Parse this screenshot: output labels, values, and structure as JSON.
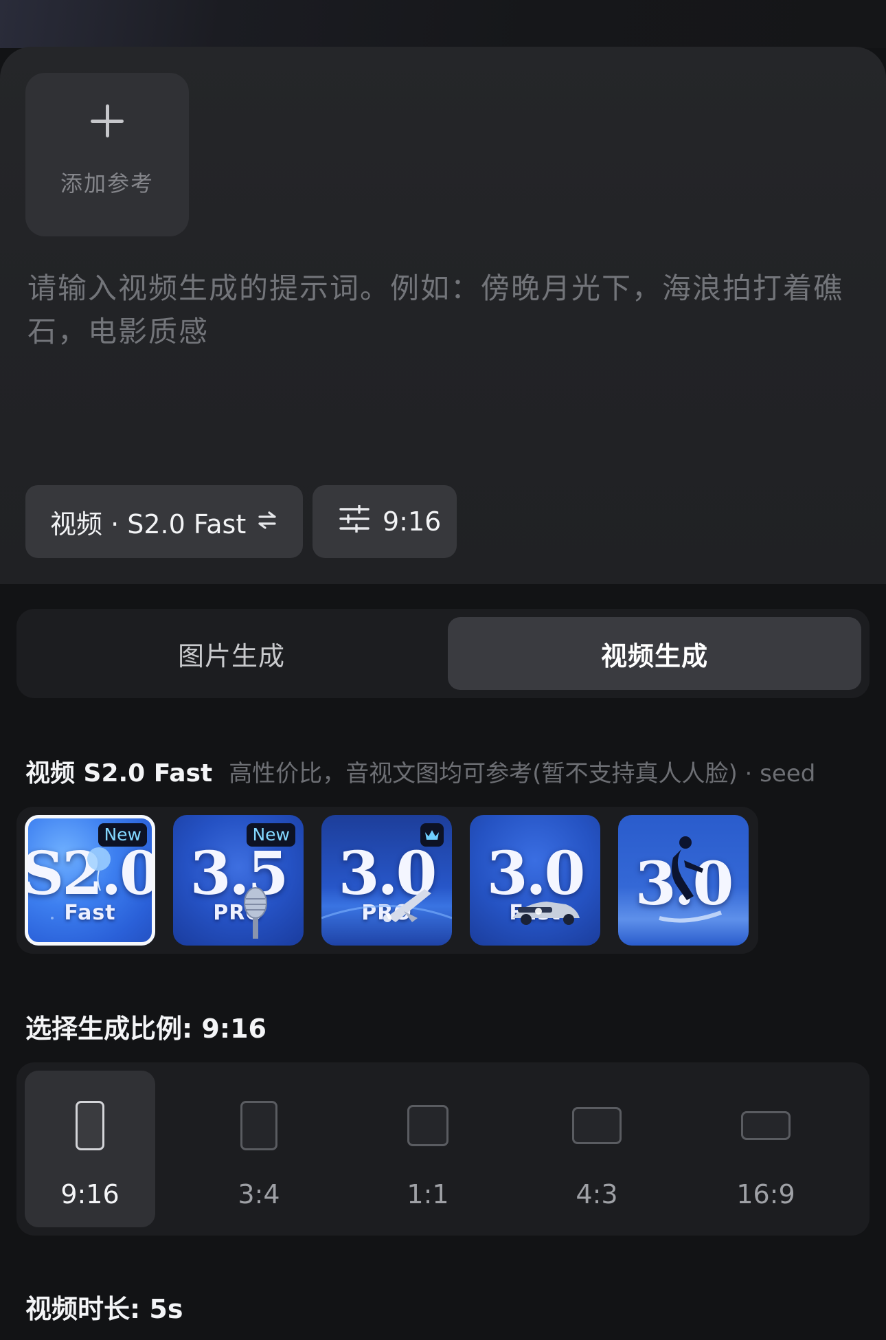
{
  "composer": {
    "add_reference_label": "添加参考",
    "prompt_placeholder": "请输入视频生成的提示词。例如：傍晚月光下，海浪拍打着礁石，电影质感",
    "model_chip_label": "视频 · S2.0 Fast",
    "model_chip_icon": "swap-arrows-icon",
    "ratio_chip_label": "9:16",
    "ratio_chip_icon": "sliders-icon"
  },
  "tabs": [
    {
      "label": "图片生成",
      "active": false
    },
    {
      "label": "视频生成",
      "active": true
    }
  ],
  "model_info": {
    "name": "视频 S2.0 Fast",
    "description": "高性价比，音视文图均可参考(暂不支持真人人脸) · seed"
  },
  "models": [
    {
      "version": "S2.0",
      "tier": "Fast",
      "badge": "New",
      "selected": true,
      "art": "balloon"
    },
    {
      "version": "3.5",
      "tier": "PRO",
      "badge": "New",
      "selected": false,
      "art": "microphone"
    },
    {
      "version": "3.0",
      "tier": "PRO",
      "badge": "crown-icon",
      "selected": false,
      "art": "space-shuttle"
    },
    {
      "version": "3.0",
      "tier": "Fast",
      "badge": "",
      "selected": false,
      "art": "sports-car"
    },
    {
      "version": "3.0",
      "tier": "",
      "badge": "",
      "selected": false,
      "art": "surfer"
    }
  ],
  "ratio_section": {
    "title": "选择生成比例: 9:16",
    "options": [
      {
        "label": "9:16",
        "active": true
      },
      {
        "label": "3:4",
        "active": false
      },
      {
        "label": "1:1",
        "active": false
      },
      {
        "label": "4:3",
        "active": false
      },
      {
        "label": "16:9",
        "active": false
      }
    ]
  },
  "duration_section": {
    "title": "视频时长: 5s"
  },
  "colors": {
    "page_bg": "#121315",
    "panel_bg": "#222326",
    "accent_blue": "#2c63d6",
    "badge_text": "#84d8ff"
  }
}
